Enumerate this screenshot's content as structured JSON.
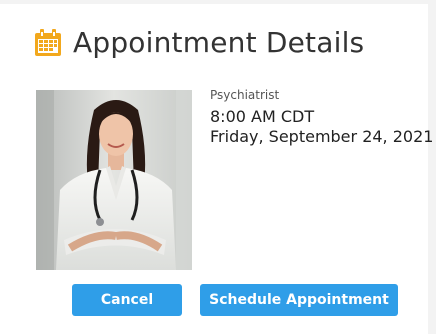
{
  "header": {
    "title": "Appointment Details",
    "icon": "calendar-icon"
  },
  "colors": {
    "accent": "#2f9ee8",
    "calendar_icon": "#f2a81d"
  },
  "appointment": {
    "role": "Psychiatrist",
    "time": "8:00 AM CDT",
    "date": "Friday, September 24, 2021"
  },
  "actions": {
    "cancel_label": "Cancel",
    "schedule_label": "Schedule Appointment"
  }
}
